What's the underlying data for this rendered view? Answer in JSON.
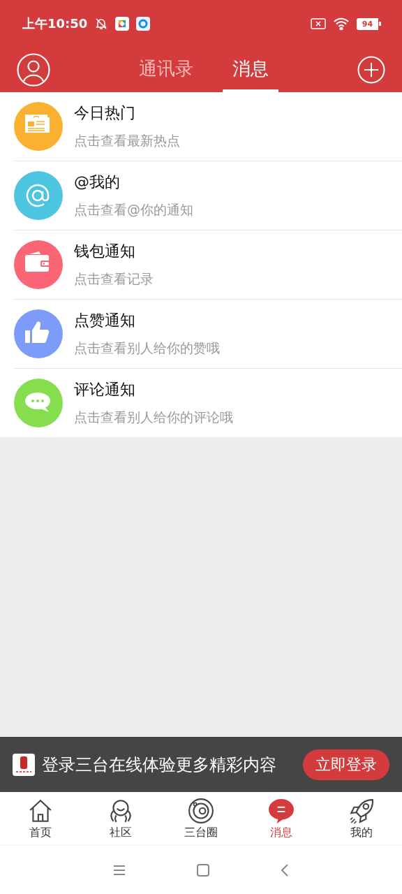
{
  "status_bar": {
    "time": "上午10:50",
    "battery": "94"
  },
  "header": {
    "tabs": [
      {
        "label": "通讯录",
        "selected": false
      },
      {
        "label": "消息",
        "selected": true
      }
    ]
  },
  "messages": [
    {
      "kind": "newspaper",
      "color": "#fbb12f",
      "title": "今日热门",
      "subtitle": "点击查看最新热点"
    },
    {
      "kind": "at",
      "color": "#4ec5e0",
      "title": "@我的",
      "subtitle": "点击查看@你的通知"
    },
    {
      "kind": "wallet",
      "color": "#fb6677",
      "title": "钱包通知",
      "subtitle": "点击查看记录"
    },
    {
      "kind": "thumb",
      "color": "#7d9cf9",
      "title": "点赞通知",
      "subtitle": "点击查看别人给你的赞哦"
    },
    {
      "kind": "chat",
      "color": "#86de4e",
      "title": "评论通知",
      "subtitle": "点击查看别人给你的评论哦"
    }
  ],
  "login_banner": {
    "text": "登录三台在线体验更多精彩内容",
    "button": "立即登录"
  },
  "bottom_nav": [
    {
      "kind": "home",
      "label": "首页",
      "selected": false
    },
    {
      "kind": "community",
      "label": "社区",
      "selected": false
    },
    {
      "kind": "planet",
      "label": "三台圈",
      "selected": false
    },
    {
      "kind": "message",
      "label": "消息",
      "selected": true
    },
    {
      "kind": "rocket",
      "label": "我的",
      "selected": false
    }
  ]
}
